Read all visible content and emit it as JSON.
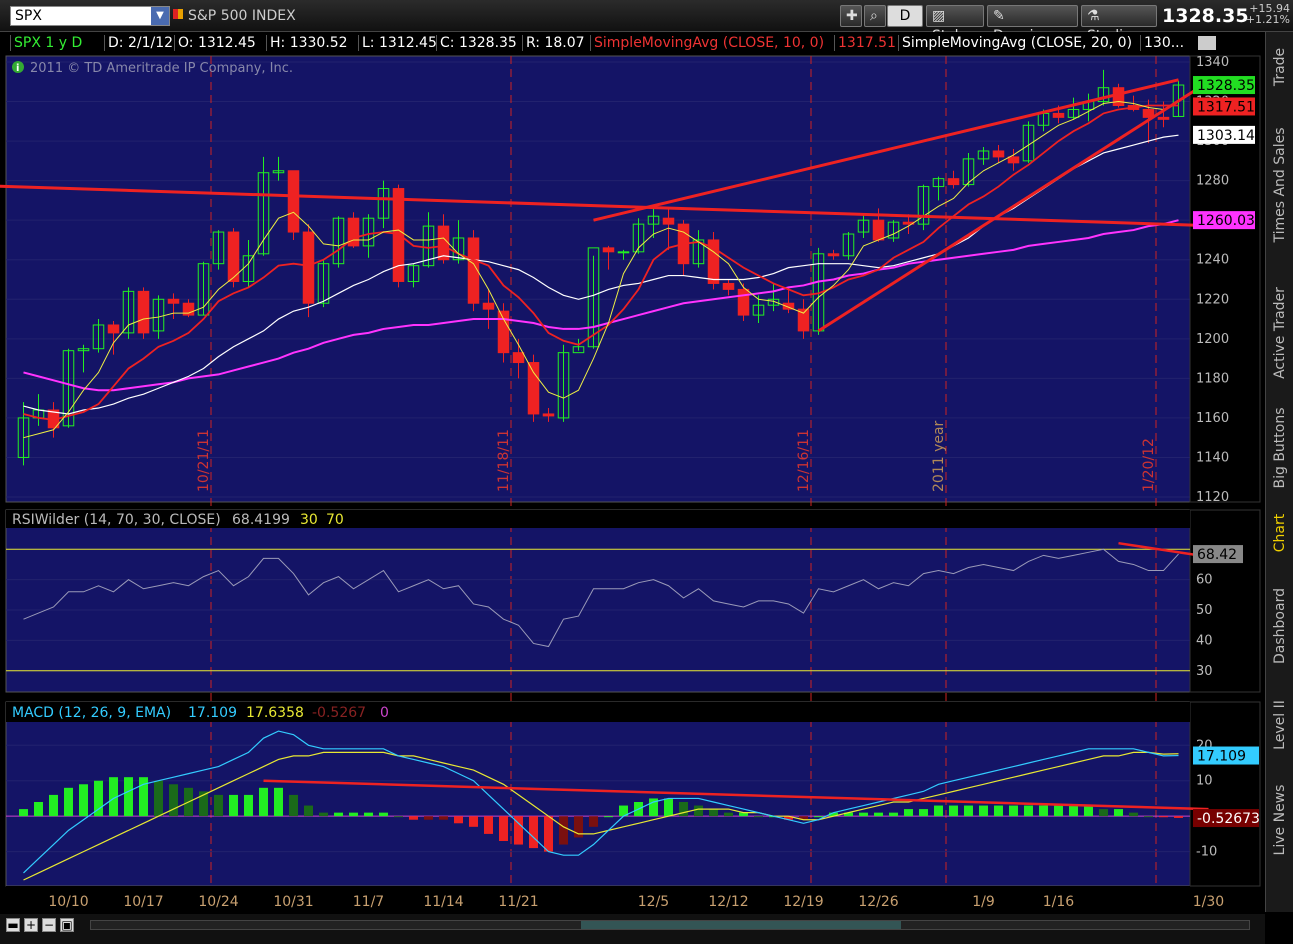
{
  "toolbar": {
    "symbol": "SPX",
    "index_name": "S&P 500 INDEX",
    "period_label": "D",
    "style_label": "Style",
    "drawings_label": "Drawings",
    "studies_label": "Studies",
    "last_price": "1328.35",
    "net_change": "+15.94",
    "net_change_pct": "+1.21%"
  },
  "side_tabs": [
    "Trade",
    "Times And Sales",
    "Active Trader",
    "Big Buttons",
    "Chart",
    "Dashboard",
    "Level II",
    "Live News"
  ],
  "active_side_tab": "Chart",
  "colors": {
    "up": "#22ee22",
    "down": "#ee2222",
    "bg": "#141466",
    "sma10": "#ee2222",
    "sma20": "#ffffff",
    "sma50": "#ff33ff",
    "sma5": "#eeee44",
    "trend": "#ee2222",
    "rsi": "#9a9ab8",
    "macd": "#33ccff",
    "signal": "#e8e833"
  },
  "header": {
    "symbol_period": "SPX 1 y D",
    "date": "D: 2/1/12",
    "open": "O: 1312.45",
    "high": "H: 1330.52",
    "low": "L: 1312.45",
    "close": "C: 1328.35",
    "range": "R: 18.07",
    "sma10_label": "SimpleMovingAvg (CLOSE, 10, 0)",
    "sma10_value": "1317.51",
    "sma20_label": "SimpleMovingAvg (CLOSE, 20, 0)",
    "sma20_value": "130...",
    "copyright": "2011 © TD Ameritrade IP Company, Inc."
  },
  "rsi_header": {
    "label": "RSIWilder (14, 70, 30, CLOSE)",
    "value": "68.4199",
    "low": "30",
    "high": "70"
  },
  "macd_header": {
    "label": "MACD (12, 26, 9, EMA)",
    "macd": "17.109",
    "signal": "17.6358",
    "hist": "-0.5267",
    "zero": "0"
  },
  "chart_data": {
    "type": "candlestick",
    "x_labels": [
      "10/10",
      "10/17",
      "10/24",
      "10/31",
      "11/7",
      "11/14",
      "11/21",
      "12/5",
      "12/12",
      "12/19",
      "12/26",
      "1/9",
      "1/16",
      "1/30"
    ],
    "x_label_index": [
      3,
      8,
      13,
      18,
      23,
      28,
      33,
      42,
      47,
      52,
      57,
      64,
      69,
      79
    ],
    "vlines": [
      {
        "index": 13,
        "label": "10/21/11"
      },
      {
        "index": 33,
        "label": "11/18/11"
      },
      {
        "index": 53,
        "label": "12/16/11"
      },
      {
        "index": 62,
        "label": "2011 year"
      },
      {
        "index": 76,
        "label": "1/20/12"
      }
    ],
    "price_axis": {
      "min": 1120,
      "max": 1340,
      "ticks": [
        1120,
        1140,
        1160,
        1180,
        1200,
        1220,
        1240,
        1260,
        1280,
        1300,
        1320,
        1340
      ]
    },
    "price_badges": [
      {
        "value": 1328.35,
        "text": "1328.35",
        "bg": "#22dd22",
        "fg": "#000000"
      },
      {
        "value": 1317.51,
        "text": "1317.51",
        "bg": "#ee2222",
        "fg": "#000000"
      },
      {
        "value": 1303.14,
        "text": "1303.14",
        "bg": "#ffffff",
        "fg": "#000000"
      },
      {
        "value": 1260.03,
        "text": "1260.03",
        "bg": "#ff33ff",
        "fg": "#000000"
      }
    ],
    "candles": [
      [
        1140,
        1168,
        1136,
        1160
      ],
      [
        1160,
        1172,
        1156,
        1164
      ],
      [
        1164,
        1168,
        1150,
        1155
      ],
      [
        1156,
        1195,
        1155,
        1194
      ],
      [
        1194,
        1197,
        1183,
        1195
      ],
      [
        1195,
        1210,
        1193,
        1207
      ],
      [
        1207,
        1209,
        1192,
        1203
      ],
      [
        1203,
        1226,
        1200,
        1224
      ],
      [
        1224,
        1226,
        1200,
        1203
      ],
      [
        1204,
        1222,
        1200,
        1220
      ],
      [
        1220,
        1223,
        1210,
        1218
      ],
      [
        1218,
        1220,
        1211,
        1212
      ],
      [
        1212,
        1239,
        1212,
        1238
      ],
      [
        1238,
        1255,
        1235,
        1254
      ],
      [
        1254,
        1256,
        1226,
        1229
      ],
      [
        1229,
        1250,
        1226,
        1242
      ],
      [
        1243,
        1292,
        1242,
        1284
      ],
      [
        1284,
        1292,
        1280,
        1285
      ],
      [
        1285,
        1285,
        1250,
        1254
      ],
      [
        1254,
        1258,
        1211,
        1218
      ],
      [
        1218,
        1240,
        1216,
        1238
      ],
      [
        1238,
        1262,
        1236,
        1261
      ],
      [
        1261,
        1264,
        1246,
        1247
      ],
      [
        1247,
        1263,
        1241,
        1261
      ],
      [
        1261,
        1280,
        1256,
        1276
      ],
      [
        1276,
        1278,
        1226,
        1229
      ],
      [
        1229,
        1238,
        1226,
        1237
      ],
      [
        1237,
        1264,
        1236,
        1257
      ],
      [
        1257,
        1263,
        1238,
        1240
      ],
      [
        1240,
        1260,
        1238,
        1251
      ],
      [
        1251,
        1255,
        1214,
        1218
      ],
      [
        1218,
        1225,
        1205,
        1215
      ],
      [
        1214,
        1218,
        1188,
        1193
      ],
      [
        1193,
        1200,
        1180,
        1188
      ],
      [
        1188,
        1192,
        1158,
        1162
      ],
      [
        1162,
        1165,
        1158,
        1161
      ],
      [
        1160,
        1197,
        1158,
        1193
      ],
      [
        1193,
        1200,
        1194,
        1196
      ],
      [
        1196,
        1242,
        1195,
        1246
      ],
      [
        1246,
        1247,
        1235,
        1244
      ],
      [
        1244,
        1245,
        1240,
        1244
      ],
      [
        1244,
        1261,
        1243,
        1258
      ],
      [
        1258,
        1266,
        1251,
        1262
      ],
      [
        1261,
        1266,
        1245,
        1258
      ],
      [
        1258,
        1260,
        1232,
        1238
      ],
      [
        1238,
        1255,
        1236,
        1250
      ],
      [
        1250,
        1254,
        1225,
        1228
      ],
      [
        1228,
        1230,
        1222,
        1225
      ],
      [
        1225,
        1228,
        1209,
        1212
      ],
      [
        1212,
        1222,
        1208,
        1217
      ],
      [
        1217,
        1228,
        1214,
        1220
      ],
      [
        1218,
        1225,
        1213,
        1215
      ],
      [
        1215,
        1220,
        1200,
        1204
      ],
      [
        1204,
        1246,
        1202,
        1243
      ],
      [
        1243,
        1245,
        1240,
        1242
      ],
      [
        1242,
        1254,
        1240,
        1253
      ],
      [
        1254,
        1263,
        1251,
        1260
      ],
      [
        1260,
        1266,
        1249,
        1250
      ],
      [
        1251,
        1260,
        1249,
        1259
      ],
      [
        1259,
        1263,
        1253,
        1258
      ],
      [
        1258,
        1278,
        1255,
        1277
      ],
      [
        1277,
        1282,
        1270,
        1281
      ],
      [
        1281,
        1285,
        1276,
        1278
      ],
      [
        1278,
        1294,
        1277,
        1291
      ],
      [
        1291,
        1297,
        1288,
        1295
      ],
      [
        1295,
        1298,
        1289,
        1292
      ],
      [
        1292,
        1296,
        1285,
        1289
      ],
      [
        1290,
        1310,
        1289,
        1308
      ],
      [
        1308,
        1316,
        1305,
        1314
      ],
      [
        1314,
        1318,
        1309,
        1312
      ],
      [
        1312,
        1322,
        1311,
        1316
      ],
      [
        1316,
        1324,
        1310,
        1320
      ],
      [
        1320,
        1336,
        1318,
        1327
      ],
      [
        1327,
        1329,
        1317,
        1318
      ],
      [
        1318,
        1323,
        1315,
        1316
      ],
      [
        1316,
        1321,
        1299,
        1312
      ],
      [
        1312,
        1320,
        1307,
        1311
      ],
      [
        1312.45,
        1330.52,
        1312.45,
        1328.35
      ]
    ],
    "sma5": [
      1150,
      1152,
      1154,
      1163,
      1174,
      1183,
      1198,
      1207,
      1210,
      1211,
      1213,
      1213,
      1216,
      1225,
      1231,
      1238,
      1250,
      1261,
      1264,
      1257,
      1248,
      1247,
      1250,
      1250,
      1254,
      1255,
      1250,
      1250,
      1251,
      1243,
      1238,
      1225,
      1210,
      1197,
      1183,
      1173,
      1170,
      1174,
      1190,
      1208,
      1233,
      1246,
      1253,
      1256,
      1254,
      1249,
      1244,
      1238,
      1226,
      1220,
      1219,
      1216,
      1213,
      1221,
      1227,
      1235,
      1247,
      1250,
      1253,
      1257,
      1262,
      1267,
      1271,
      1279,
      1285,
      1289,
      1293,
      1298,
      1303,
      1308,
      1311,
      1315,
      1319,
      1320,
      1319,
      1317,
      1316,
      1320
    ],
    "sma10": [
      1162,
      1160,
      1159,
      1161,
      1163,
      1167,
      1176,
      1185,
      1190,
      1196,
      1199,
      1203,
      1210,
      1219,
      1223,
      1226,
      1231,
      1237,
      1238,
      1237,
      1240,
      1245,
      1251,
      1253,
      1254,
      1253,
      1247,
      1246,
      1247,
      1243,
      1240,
      1237,
      1227,
      1221,
      1213,
      1203,
      1199,
      1197,
      1202,
      1207,
      1215,
      1225,
      1240,
      1246,
      1248,
      1249,
      1246,
      1241,
      1236,
      1232,
      1228,
      1225,
      1222,
      1223,
      1226,
      1230,
      1232,
      1235,
      1241,
      1245,
      1249,
      1256,
      1262,
      1268,
      1272,
      1277,
      1283,
      1288,
      1294,
      1300,
      1305,
      1309,
      1314,
      1316,
      1317,
      1318,
      1318,
      1318
    ],
    "sma20": [
      1166,
      1164,
      1163,
      1162,
      1164,
      1165,
      1167,
      1170,
      1172,
      1175,
      1178,
      1181,
      1185,
      1191,
      1196,
      1200,
      1204,
      1210,
      1214,
      1216,
      1219,
      1223,
      1227,
      1230,
      1234,
      1237,
      1238,
      1240,
      1242,
      1241,
      1240,
      1239,
      1237,
      1235,
      1231,
      1226,
      1222,
      1220,
      1222,
      1225,
      1227,
      1228,
      1230,
      1232,
      1232,
      1231,
      1230,
      1230,
      1230,
      1231,
      1233,
      1236,
      1237,
      1238,
      1238,
      1238,
      1237,
      1236,
      1237,
      1239,
      1241,
      1243,
      1247,
      1251,
      1257,
      1262,
      1266,
      1271,
      1276,
      1281,
      1286,
      1290,
      1294,
      1296,
      1298,
      1300,
      1302,
      1303
    ],
    "sma50": [
      1183,
      1181,
      1179,
      1177,
      1175,
      1174,
      1174,
      1175,
      1176,
      1177,
      1178,
      1180,
      1181,
      1182,
      1184,
      1186,
      1188,
      1190,
      1193,
      1195,
      1198,
      1200,
      1202,
      1203,
      1205,
      1206,
      1207,
      1207,
      1208,
      1209,
      1210,
      1210,
      1210,
      1209,
      1208,
      1206,
      1205,
      1205,
      1206,
      1208,
      1210,
      1212,
      1214,
      1216,
      1218,
      1219,
      1220,
      1221,
      1222,
      1223,
      1224,
      1226,
      1227,
      1229,
      1230,
      1232,
      1233,
      1235,
      1236,
      1238,
      1239,
      1240,
      1241,
      1242,
      1243,
      1244,
      1245,
      1247,
      1248,
      1249,
      1250,
      1251,
      1253,
      1254,
      1255,
      1257,
      1258,
      1260
    ],
    "trendlines": [
      {
        "i1": -5,
        "v1": 1278,
        "i2": 80,
        "v2": 1257
      },
      {
        "i1": 38,
        "v1": 1260,
        "i2": 77,
        "v2": 1331
      },
      {
        "i1": 53,
        "v1": 1204,
        "i2": 79,
        "v2": 1330
      }
    ],
    "rsi": {
      "axis": {
        "min": 25,
        "max": 77,
        "ticks": [
          30,
          40,
          50,
          60
        ]
      },
      "levels": [
        30,
        70
      ],
      "badge": "68.42",
      "values": [
        47,
        49,
        51,
        56,
        56,
        58,
        56,
        60,
        57,
        58,
        59,
        58,
        61,
        63,
        58,
        61,
        67,
        67,
        62,
        55,
        59,
        61,
        57,
        60,
        63,
        56,
        58,
        60,
        57,
        58,
        52,
        51,
        47,
        45,
        39,
        38,
        47,
        48,
        57,
        57,
        57,
        59,
        60,
        58,
        54,
        57,
        53,
        52,
        51,
        53,
        53,
        52,
        49,
        57,
        56,
        58,
        60,
        57,
        59,
        58,
        62,
        63,
        62,
        64,
        65,
        64,
        63,
        66,
        68,
        67,
        68,
        69,
        70,
        66,
        65,
        63,
        63,
        68.42
      ],
      "trendline": {
        "i1": 73,
        "v1": 72,
        "i2": 81,
        "v2": 66
      }
    },
    "macd": {
      "axis": {
        "min": -18,
        "max": 26,
        "ticks": [
          -10,
          10,
          20
        ]
      },
      "badges": [
        {
          "value": 17.109,
          "text": "17.109",
          "bg": "#33ccff",
          "fg": "#000000"
        },
        {
          "value": -0.52673,
          "text": "-0.52673",
          "bg": "#770000",
          "fg": "#ffffff"
        }
      ],
      "macd": [
        -16,
        -12,
        -8,
        -4,
        -1,
        2,
        5,
        7,
        9,
        10,
        11,
        12,
        13,
        14,
        16,
        18,
        22,
        24,
        23,
        20,
        19,
        19,
        19,
        19,
        19,
        17,
        16,
        15,
        14,
        12,
        10,
        6,
        2,
        -2,
        -6,
        -10,
        -11,
        -11,
        -8,
        -4,
        0,
        2,
        4,
        5,
        5,
        5,
        4,
        3,
        2,
        1,
        0,
        -1,
        -2,
        -1,
        1,
        2,
        3,
        4,
        5,
        6,
        7,
        9,
        10,
        11,
        12,
        13,
        14,
        15,
        16,
        17,
        18,
        19,
        19,
        19,
        19,
        18,
        17,
        17.1
      ],
      "signal": [
        -18,
        -16,
        -14,
        -12,
        -10,
        -8,
        -6,
        -4,
        -2,
        0,
        2,
        4,
        6,
        8,
        10,
        12,
        14,
        16,
        17,
        17,
        18,
        18,
        18,
        18,
        18,
        17,
        17,
        16,
        15,
        14,
        13,
        11,
        9,
        6,
        3,
        0,
        -3,
        -5,
        -5,
        -4,
        -3,
        -2,
        -1,
        0,
        1,
        2,
        2,
        2,
        1,
        1,
        0,
        0,
        -1,
        -1,
        0,
        1,
        2,
        3,
        4,
        4,
        5,
        6,
        7,
        8,
        9,
        10,
        11,
        12,
        13,
        14,
        15,
        16,
        17,
        17,
        18,
        18,
        17.5,
        17.6
      ],
      "hist": [
        2,
        4,
        6,
        8,
        9,
        10,
        11,
        11,
        11,
        10,
        9,
        8,
        7,
        6,
        6,
        6,
        8,
        8,
        6,
        3,
        1,
        1,
        1,
        1,
        1,
        0,
        -1,
        -1,
        -1,
        -2,
        -3,
        -5,
        -7,
        -8,
        -9,
        -10,
        -8,
        -6,
        -3,
        0,
        3,
        4,
        5,
        5,
        4,
        3,
        2,
        1,
        1,
        0,
        0,
        -1,
        -1,
        0,
        1,
        1,
        1,
        1,
        1,
        2,
        2,
        3,
        3,
        3,
        3,
        3,
        3,
        3,
        3,
        3,
        3,
        3,
        2,
        2,
        1,
        0,
        -0.3,
        -0.5
      ],
      "trendline": {
        "i1": 16,
        "v1": 10,
        "i2": 79,
        "v2": 2
      }
    }
  }
}
